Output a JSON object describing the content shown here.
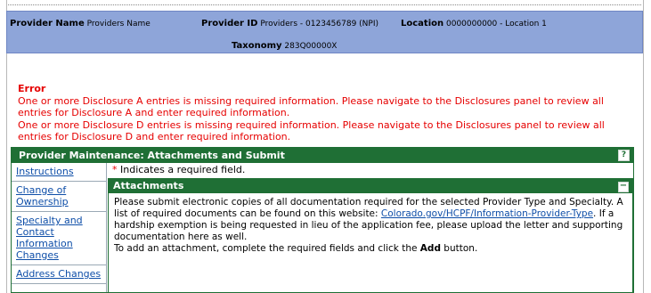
{
  "provider": {
    "name_label": "Provider Name",
    "name_value": "Providers Name",
    "id_label": "Provider ID",
    "id_value": "Providers - 0123456789 (NPI)",
    "location_label": "Location",
    "location_value": "0000000000 - Location 1",
    "taxonomy_label": "Taxonomy",
    "taxonomy_value": "283Q00000X"
  },
  "errors": {
    "title": "Error",
    "messages": [
      "One or more Disclosure A entries is missing required information. Please navigate to the Disclosures panel to review all entries for Disclosure A and enter required information.",
      "One or more Disclosure D entries is missing required information. Please navigate to the Disclosures panel to review all entries for Disclosure D and enter required information."
    ]
  },
  "panel": {
    "title": "Provider Maintenance: Attachments and Submit",
    "help_label": "?"
  },
  "nav": {
    "items": [
      {
        "label": "Instructions"
      },
      {
        "label": "Change of Ownership"
      },
      {
        "label": "Specialty and Contact Information Changes"
      },
      {
        "label": "Address Changes"
      }
    ]
  },
  "required_note": {
    "star": "*",
    "text": "Indicates a required field."
  },
  "attachments": {
    "title": "Attachments",
    "collapse_label": "−",
    "body_part1": "Please submit electronic copies of all documentation required for the selected Provider Type and Specialty. A list of required documents can be found on this website: ",
    "link": "Colorado.gov/HCPF/Information-Provider-Type",
    "body_part2": ". If a hardship exemption is being requested in lieu of the application fee, please upload the letter and supporting documentation here as well.",
    "instruction_part1": "To add an attachment, complete the required fields and click the ",
    "instruction_bold": "Add",
    "instruction_part2": " button."
  }
}
